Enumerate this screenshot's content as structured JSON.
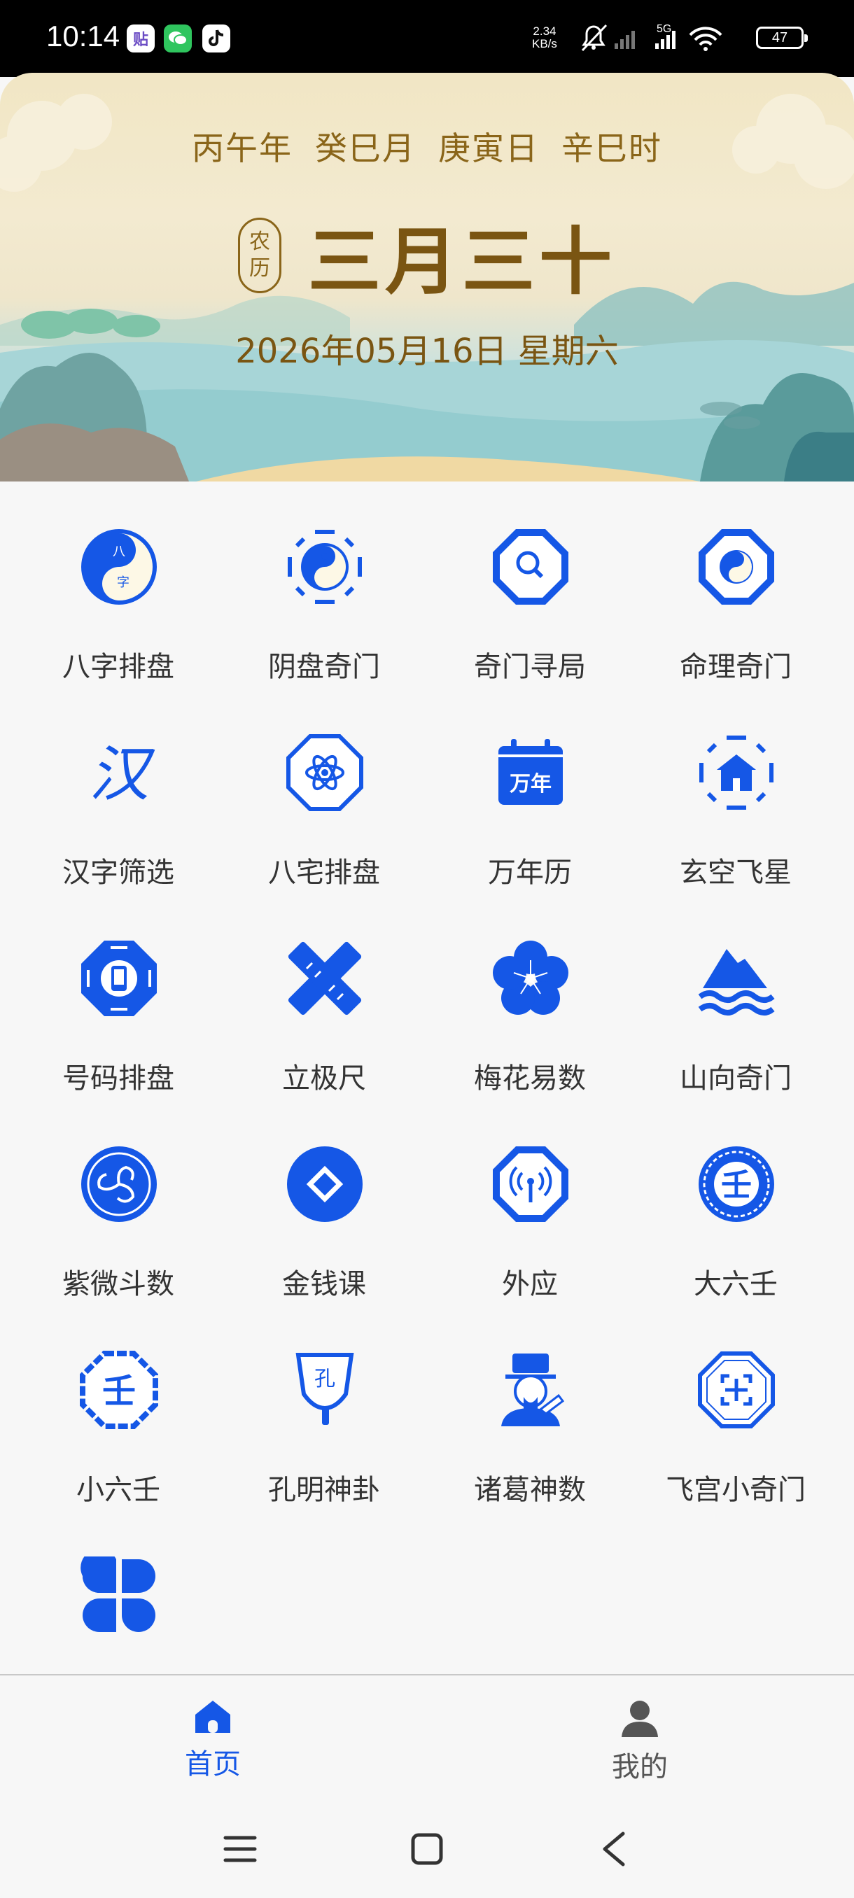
{
  "status_bar": {
    "time": "10:14",
    "apps": [
      "贴",
      "wechat-icon",
      "tiktok-icon"
    ],
    "net_speed_value": "2.34",
    "net_speed_unit": "KB/s",
    "signal": "5G",
    "battery": "47"
  },
  "header": {
    "ganzhi": [
      "丙午年",
      "癸巳月",
      "庚寅日",
      "辛巳时"
    ],
    "lunar_seal": [
      "农",
      "历"
    ],
    "lunar_date": "三月三十",
    "gregorian_date": "2026年05月16日 星期六"
  },
  "tools": [
    {
      "label": "八字排盘",
      "icon": "yinyang-bazi-icon"
    },
    {
      "label": "阴盘奇门",
      "icon": "bagua-yinyang-icon"
    },
    {
      "label": "奇门寻局",
      "icon": "octagon-search-icon"
    },
    {
      "label": "命理奇门",
      "icon": "octagon-yinyang-icon"
    },
    {
      "label": "汉字筛选",
      "icon": "han-character-icon"
    },
    {
      "label": "八宅排盘",
      "icon": "octagon-atom-icon"
    },
    {
      "label": "万年历",
      "icon": "calendar-icon"
    },
    {
      "label": "玄空飞星",
      "icon": "bagua-house-icon"
    },
    {
      "label": "号码排盘",
      "icon": "bagua-phone-icon"
    },
    {
      "label": "立极尺",
      "icon": "ruler-icon"
    },
    {
      "label": "梅花易数",
      "icon": "plum-blossom-icon"
    },
    {
      "label": "山向奇门",
      "icon": "mountain-water-icon"
    },
    {
      "label": "紫微斗数",
      "icon": "swirl-circle-icon"
    },
    {
      "label": "金钱课",
      "icon": "coin-icon"
    },
    {
      "label": "外应",
      "icon": "octagon-signal-icon"
    },
    {
      "label": "大六壬",
      "icon": "circle-ren-icon"
    },
    {
      "label": "小六壬",
      "icon": "bagua-ren-icon"
    },
    {
      "label": "孔明神卦",
      "icon": "feather-fan-icon"
    },
    {
      "label": "诸葛神数",
      "icon": "zhuge-portrait-icon"
    },
    {
      "label": "飞宫小奇门",
      "icon": "octagon-grid-icon"
    },
    {
      "label": "",
      "icon": "four-leaf-more-icon"
    }
  ],
  "bottom_nav": {
    "home_label": "首页",
    "me_label": "我的"
  },
  "colors": {
    "accent": "#1557e6",
    "gold": "#8a6519"
  }
}
